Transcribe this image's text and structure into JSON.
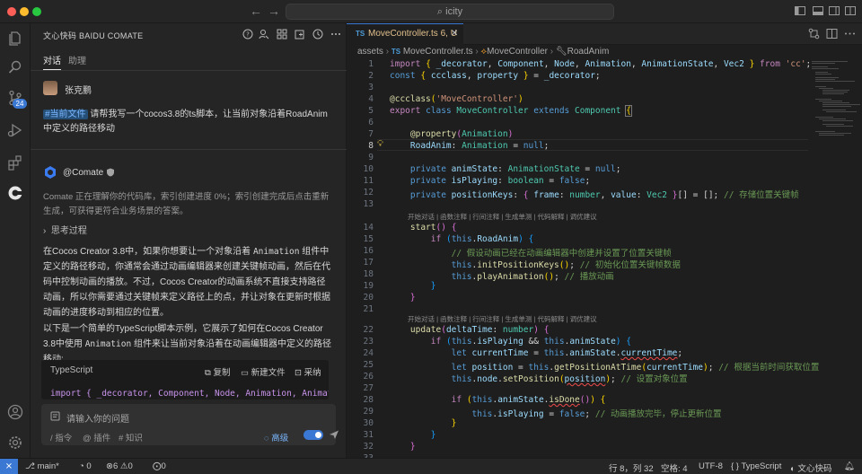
{
  "window": {
    "search_text": "icity"
  },
  "activity_bar": {
    "scm_badge": "24"
  },
  "chat": {
    "header_title": "文心快码 BAIDU COMATE",
    "tabs": [
      {
        "label": "对话",
        "active": true
      },
      {
        "label": "助理",
        "active": false
      }
    ],
    "user_name": "张克鹏",
    "user_tag": "#当前文件",
    "user_message": " 请帮我写一个cocos3.8的ts脚本，让当前对象沿着RoadAnim中定义的路径移动",
    "bot_name": "@Comate",
    "index_notice": "Comate 正在理解你的代码库，索引创建进度 0%；索引创建完成后点击重新生成，可获得更符合业务场景的答案。",
    "thinking_label": "思考过程",
    "paragraph1_a": "在Cocos Creator 3.8中，如果你想要让一个对象沿着",
    "paragraph1_code": "Animation",
    "paragraph1_b": "组件中定义的路径移动，你通常会通过动画编辑器来创建关键帧动画，然后在代码中控制动画的播放。不过，Cocos Creator的动画系统不直接支持路径动画，所以你需要通过关键帧来定义路径上的点，并让对象在更新时根据动画的进度移动到相应的位置。",
    "paragraph2_a": "以下是一个简单的TypeScript脚本示例，它展示了如何在Cocos Creator 3.8中使用",
    "paragraph2_code": "Animation",
    "paragraph2_b": "组件来让当前对象沿着在动画编辑器中定义的路径移动:",
    "codeblock": {
      "language": "TypeScript",
      "copy_label": "复制",
      "new_file_label": "新建文件",
      "accept_label": "采纳",
      "first_line": "import { _decorator, Component, Node, Animation, AnimationSt"
    },
    "input": {
      "placeholder": "请输入你的问题",
      "command_hint": "/ 指令",
      "plugin_hint": "@ 插件",
      "knowledge_hint": "# 知识",
      "advanced_label": "高级"
    }
  },
  "editor": {
    "tab_lang": "TS",
    "tab_filename": "MoveController.ts",
    "tab_status": "6, U",
    "breadcrumb": {
      "folder": "assets",
      "file": "MoveController.ts",
      "class": "MoveController",
      "member": "RoadAnim"
    },
    "code_lens_1": "开始对话 | 函数注释 | 行间注释 | 生成单测 | 代码解释 | 调优建议",
    "code_lens_2": "开始对话 | 函数注释 | 行间注释 | 生成单测 | 代码解释 | 调优建议",
    "line_numbers": [
      "1",
      "2",
      "3",
      "4",
      "5",
      "6",
      "7",
      "8",
      "9",
      "10",
      "11",
      "12",
      "13",
      "14",
      "15",
      "16",
      "17",
      "18",
      "19",
      "20",
      "21",
      "22",
      "23",
      "24",
      "25",
      "26",
      "27",
      "28",
      "29",
      "30",
      "31",
      "32",
      "33"
    ]
  },
  "status_bar": {
    "branch": "main*",
    "sync": "0",
    "errors": "6",
    "warnings": "0",
    "ports": "0",
    "position": "行 8，列 32",
    "spaces": "空格: 4",
    "encoding": "UTF-8",
    "language": "{ } TypeScript",
    "plugin": "文心快码"
  },
  "colors": {
    "accent": "#3a78d4",
    "background": "#1e1e1e",
    "panel": "#252526"
  }
}
